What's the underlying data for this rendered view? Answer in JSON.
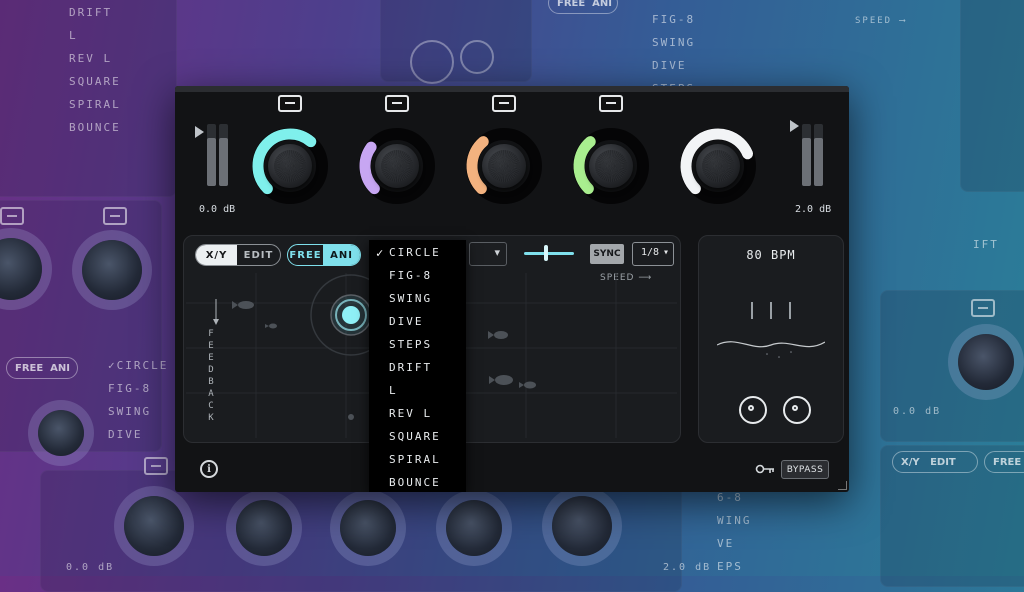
{
  "background": {
    "menu_left": [
      "DRIFT",
      "L",
      "REV L",
      "SQUARE",
      "SPIRAL",
      "BOUNCE"
    ],
    "menu_top": [
      "FIG-8",
      "SWING",
      "DIVE",
      "STEPS"
    ],
    "menu_lower": [
      "CIRCLE",
      "FIG-8",
      "SWING",
      "DIVE"
    ],
    "menu_bottom": [
      "6-8",
      "WING",
      "VE",
      "EPS"
    ],
    "pill_free": "FREE",
    "pill_ani": "ANI",
    "pill_xy": "X/Y",
    "pill_edit": "EDIT",
    "speed": "SPEED",
    "db_a": "0.0 dB",
    "db_b": "0.0 dB",
    "db_c": "2.0 dB",
    "lift": "IFT",
    "feedback_char": "F\nE"
  },
  "plugin": {
    "input_db": "0.0 dB",
    "output_db": "2.0 dB",
    "knob_colors": [
      "#7ff0ec",
      "#c7a6f2",
      "#f3b27f",
      "#a9ee8f",
      "#f2f4f6"
    ],
    "knob_levels": [
      0.65,
      0.3,
      0.35,
      0.35,
      0.75
    ],
    "mode_tabs": {
      "xy": "X/Y",
      "edit": "EDIT",
      "active": "X/Y"
    },
    "anim_tabs": {
      "free": "FREE",
      "ani": "ANI",
      "active": "ANI"
    },
    "speed_slider_level": 0.45,
    "sync_label": "SYNC",
    "rate_value": "1/8",
    "speed_label": "SPEED",
    "feedback_label": "FEEDBACK",
    "bpm": "80 BPM",
    "bypass_label": "BYPASS",
    "info_label": "i"
  },
  "motion_menu": {
    "selected": "CIRCLE",
    "items": [
      "CIRCLE",
      "FIG-8",
      "SWING",
      "DIVE",
      "STEPS",
      "DRIFT",
      "L",
      "REV L",
      "SQUARE",
      "SPIRAL",
      "BOUNCE"
    ]
  }
}
